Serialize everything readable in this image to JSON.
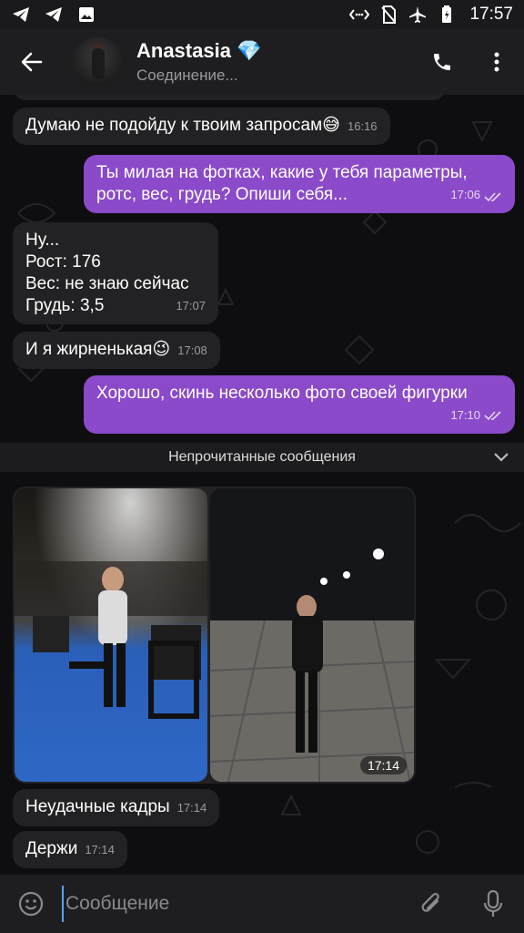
{
  "status_bar": {
    "time": "17:57",
    "left_icons": [
      "telegram-icon",
      "telegram-icon",
      "gallery-icon"
    ],
    "right_icons": [
      "nfc-icon",
      "no-sim-icon",
      "airplane-icon",
      "battery-icon"
    ]
  },
  "header": {
    "name": "Anastasia",
    "name_badge": "💎",
    "status": "Соединение..."
  },
  "messages": [
    {
      "dir": "in",
      "text": "Думаю не подойду к твоим запросам😅",
      "time": "16:16"
    },
    {
      "dir": "out",
      "lines": [
        "Ты милая на фотках, какие у тебя параметры,",
        "ротс, вес, грудь? Опиши себя..."
      ],
      "time": "17:06"
    },
    {
      "dir": "in",
      "lines": [
        "Ну...",
        "Рост: 176",
        "Вес: не знаю сейчас",
        "Грудь: 3,5"
      ],
      "time": "17:07"
    },
    {
      "dir": "in",
      "text": "И я жирненькая😉",
      "time": "17:08"
    },
    {
      "dir": "out",
      "text": "Хорошо, скинь несколько фото своей фигурки",
      "time": "17:10"
    }
  ],
  "unread_divider": "Непрочитанные сообщения",
  "album": {
    "time": "17:14"
  },
  "after_messages": [
    {
      "dir": "in",
      "text": "Неудачные кадры",
      "time": "17:14"
    },
    {
      "dir": "in",
      "text": "Держи",
      "time": "17:14"
    }
  ],
  "input": {
    "placeholder": "Сообщение"
  },
  "colors": {
    "outgoing_bubble": "#8a4ac9",
    "incoming_bubble": "#222224",
    "accent": "#5aa0ff"
  }
}
